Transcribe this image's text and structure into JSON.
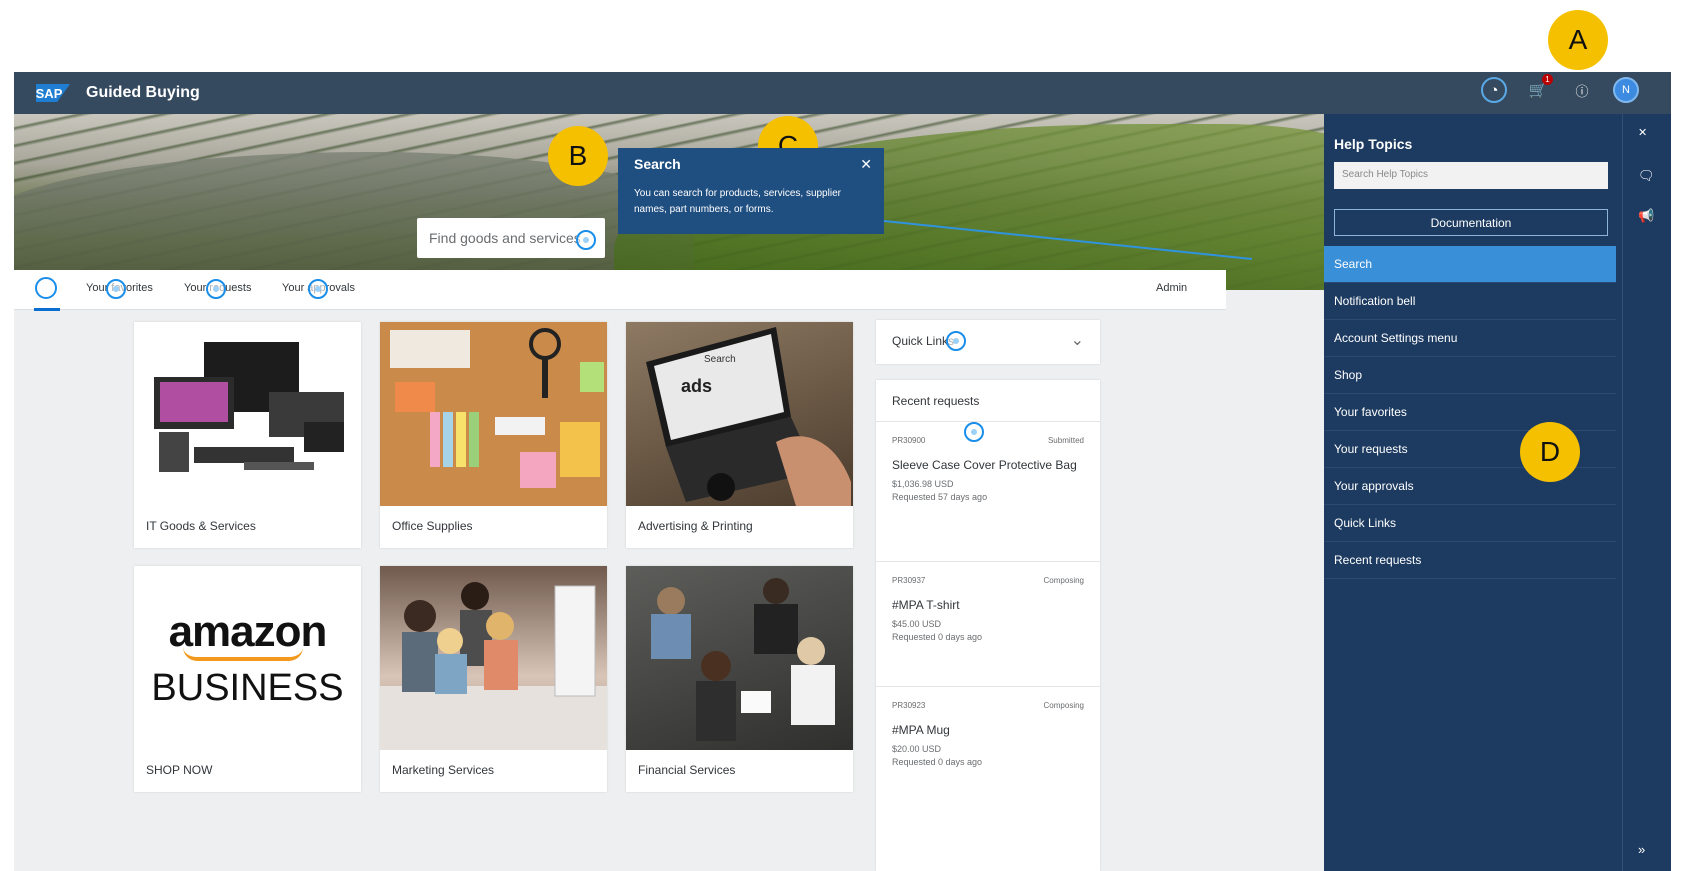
{
  "shell": {
    "logo": "SAP",
    "title": "Guided Buying",
    "cart_count": "1",
    "avatar": "N"
  },
  "search": {
    "placeholder": "Find goods and services"
  },
  "popover": {
    "title": "Search",
    "body": "You can search for products, services, supplier names, part numbers, or forms."
  },
  "nav": {
    "tabs": [
      "Your favorites",
      "Your requests",
      "Your approvals"
    ],
    "admin": "Admin"
  },
  "tiles": [
    {
      "label": "IT Goods & Services"
    },
    {
      "label": "Office Supplies"
    },
    {
      "label": "Advertising & Printing"
    },
    {
      "label": "SHOP NOW",
      "logo_line1": "amazon",
      "logo_line2": "BUSINESS"
    },
    {
      "label": "Marketing Services"
    },
    {
      "label": "Financial Services"
    }
  ],
  "adv_screen_text": [
    "Search",
    "ads"
  ],
  "quick_links": {
    "label": "Quick Links"
  },
  "recent_requests": {
    "title": "Recent requests",
    "items": [
      {
        "id": "PR30900",
        "status": "Submitted",
        "name": "Sleeve Case Cover Protective Bag",
        "price": "$1,036.98 USD",
        "age": "Requested 57 days ago"
      },
      {
        "id": "PR30937",
        "status": "Composing",
        "name": "#MPA T-shirt",
        "price": "$45.00 USD",
        "age": "Requested 0 days ago"
      },
      {
        "id": "PR30923",
        "status": "Composing",
        "name": "#MPA Mug",
        "price": "$20.00 USD",
        "age": "Requested 0 days ago"
      }
    ]
  },
  "help": {
    "title": "Help Topics",
    "search_placeholder": "Search Help Topics",
    "doc_button": "Documentation",
    "topics": [
      "Search",
      "Notification bell",
      "Account Settings menu",
      "Shop",
      "Your favorites",
      "Your requests",
      "Your approvals",
      "Quick Links",
      "Recent requests"
    ],
    "selected": "Search"
  },
  "callouts": [
    "A",
    "B",
    "C",
    "D"
  ],
  "colors": {
    "shell": "#354a5f",
    "help_panel": "#1d3b60",
    "selected_topic": "#3a8fd9",
    "callout": "#f5c000",
    "hotspot": "#1a8ee8"
  }
}
